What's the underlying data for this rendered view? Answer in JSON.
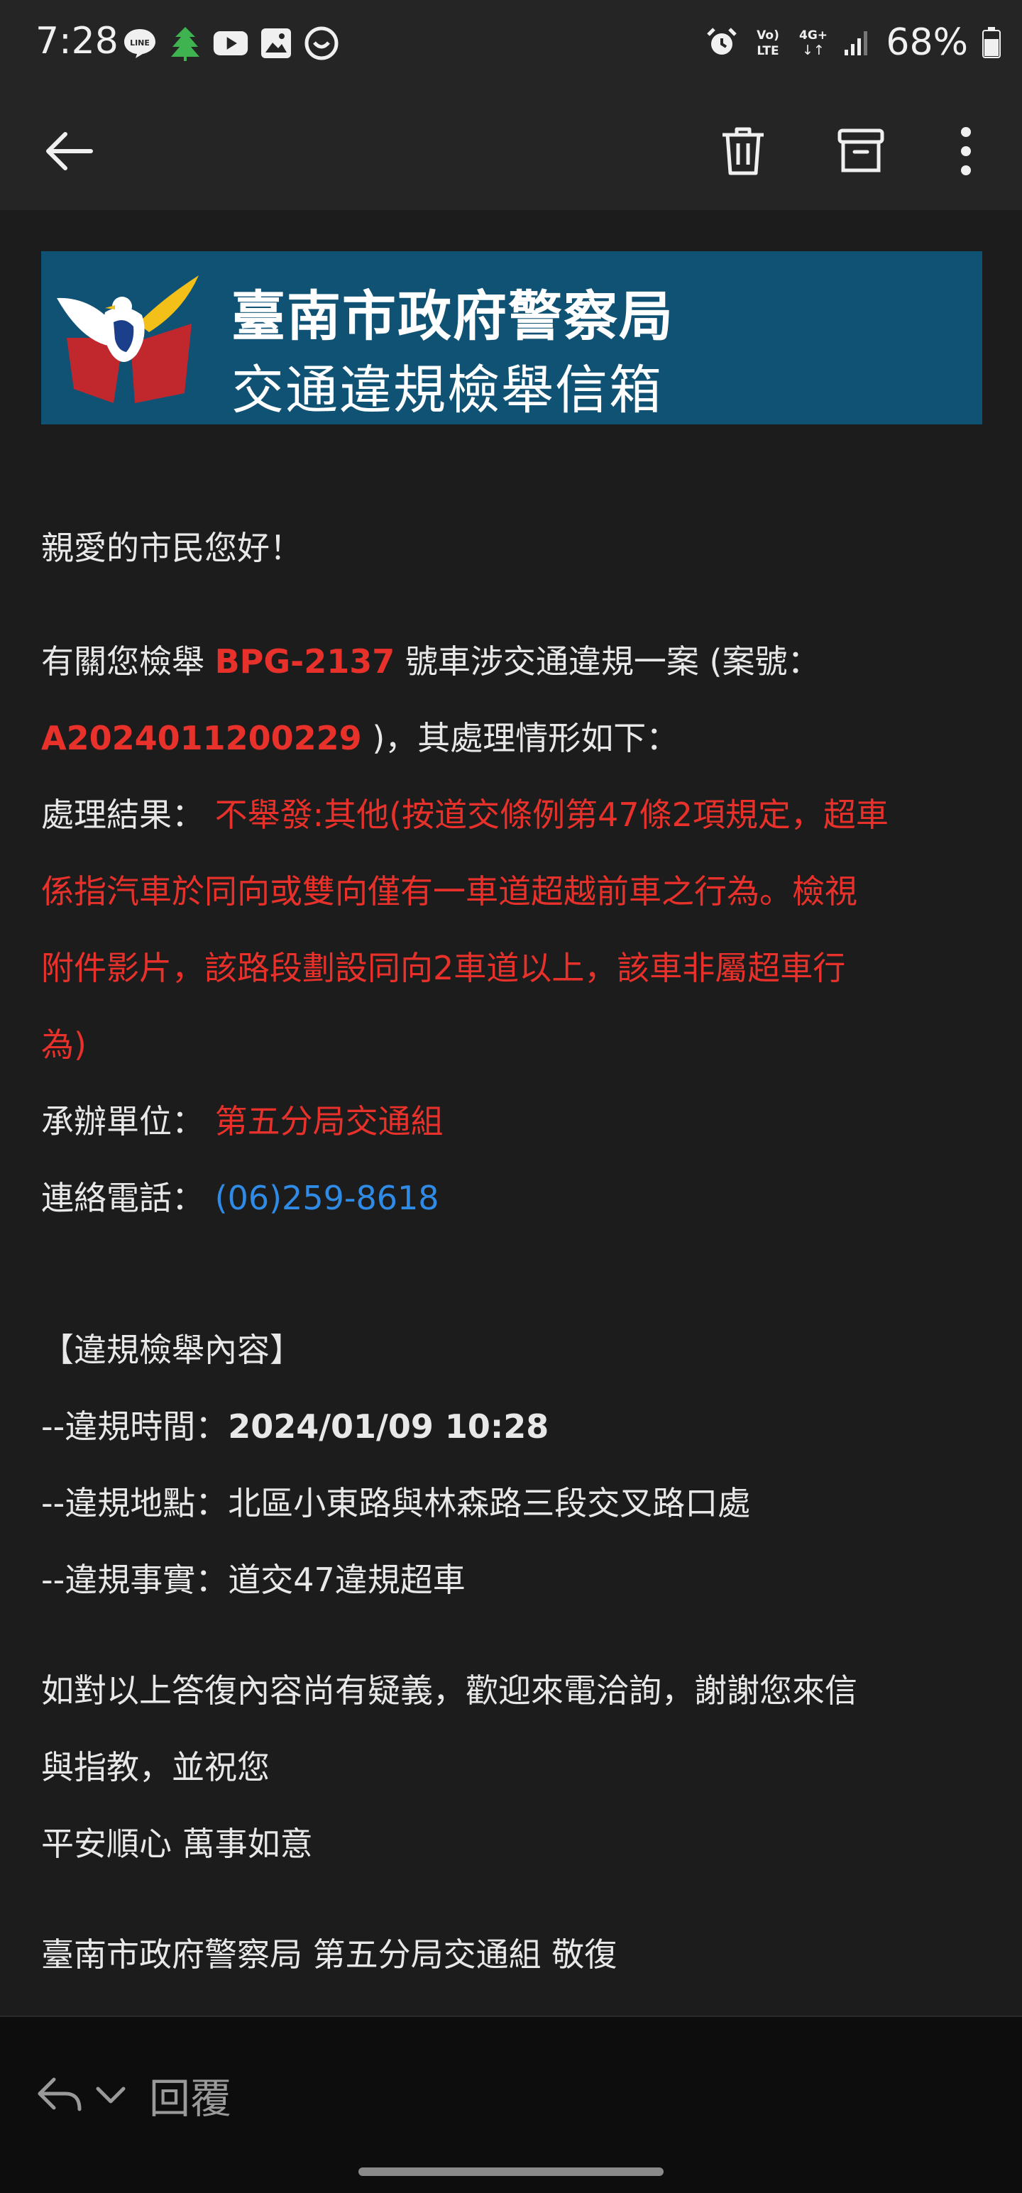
{
  "status_bar": {
    "time": "7:28",
    "battery": "68%",
    "icons_left": [
      "line-icon",
      "leaf-app-icon",
      "youtube-icon",
      "gallery-icon",
      "chat-icon"
    ],
    "icons_right": [
      "alarm-icon",
      "volte-icon",
      "4g-icon",
      "signal-icon",
      "battery-icon"
    ],
    "net_labels": {
      "volte_top": "Vo)",
      "volte_bottom": "LTE",
      "fourg_top": "4G+",
      "fourg_bottom": "↓↑"
    }
  },
  "toolbar": {
    "back": "back-arrow-icon",
    "actions": [
      "delete-icon",
      "archive-icon",
      "more-options-icon"
    ]
  },
  "banner": {
    "title": "臺南市政府警察局",
    "subtitle": "交通違規檢舉信箱"
  },
  "email": {
    "greeting": "親愛的市民您好！",
    "intro_prefix": "有關您檢舉 ",
    "plate": "BPG-2137",
    "intro_suffix": " 號車涉交通違規一案 (案號：",
    "case_no": "A2024011200229",
    "case_suffix": " )，其處理情形如下：",
    "result_label": "處理結果： ",
    "result_lines": [
      "不舉發:其他(按道交條例第47條2項規定，超車",
      "係指汽車於同向或雙向僅有一車道超越前車之行為。檢視",
      "附件影片，該路段劃設同向2車道以上，該車非屬超車行",
      "為)"
    ],
    "unit_label": "承辦單位： ",
    "unit_value": "第五分局交通組",
    "phone_label": "連絡電話： ",
    "phone_value": "(06)259-8618",
    "section_title": "【違規檢舉內容】",
    "time_label": "--違規時間：",
    "time_value": "2024/01/09 10:28",
    "place_label": "--違規地點：",
    "place_value": "北區小東路與林森路三段交叉路口處",
    "fact_label": "--違規事實：",
    "fact_value": "道交47違規超車",
    "closing_lines": [
      "如對以上答復內容尚有疑義，歡迎來電洽詢，謝謝您來信",
      "與指教，並祝您",
      "平安順心 萬事如意"
    ],
    "signature": "臺南市政府警察局 第五分局交通組 敬復"
  },
  "bottom_bar": {
    "reply_label": "回覆"
  },
  "colors": {
    "accent_red": "#e8312b",
    "link_blue": "#2f8be6",
    "banner_bg": "#0f5274"
  }
}
